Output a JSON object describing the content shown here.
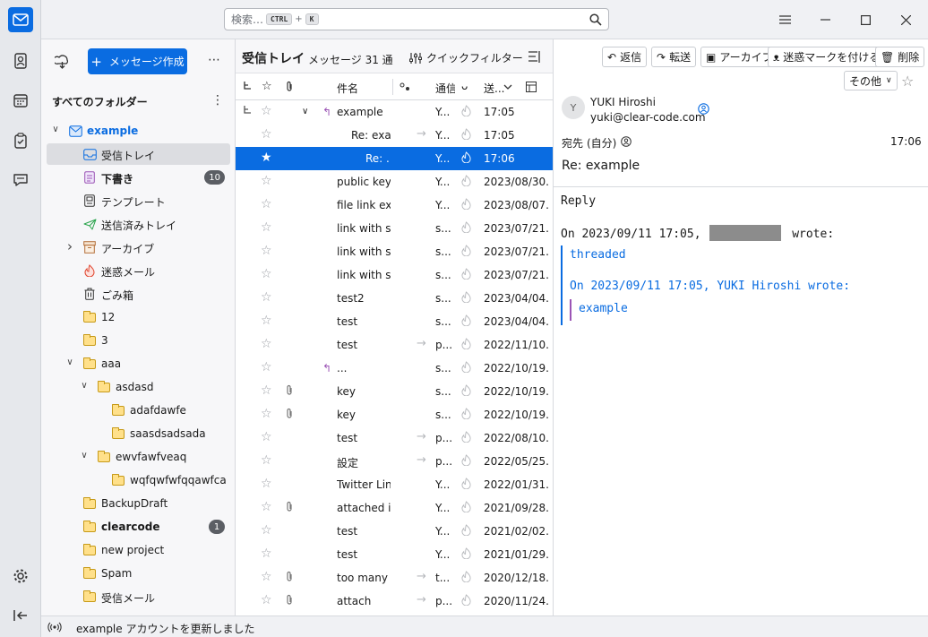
{
  "spaces": {
    "items": [
      "mail",
      "address-book",
      "calendar",
      "tasks",
      "chat"
    ],
    "bottom": [
      "settings",
      "collapse"
    ]
  },
  "search": {
    "placeholder": "検索…",
    "key1": "CTRL",
    "plus": "+",
    "key2": "K"
  },
  "folders": {
    "compose_label": "メッセージ作成",
    "header": "すべてのフォルダー",
    "more": "⋯",
    "menu": "⋮",
    "items": [
      {
        "label": "example",
        "depth": 0,
        "twisty": "open",
        "icon": "account-icon",
        "bold": true,
        "accent": true
      },
      {
        "label": "受信トレイ",
        "depth": 1,
        "icon": "inbox-icon",
        "selected": true
      },
      {
        "label": "下書き",
        "depth": 1,
        "icon": "drafts-icon",
        "bold": true,
        "badge": "10"
      },
      {
        "label": "テンプレート",
        "depth": 1,
        "icon": "template-icon"
      },
      {
        "label": "送信済みトレイ",
        "depth": 1,
        "icon": "sent-icon"
      },
      {
        "label": "アーカイブ",
        "depth": 1,
        "twisty": "closed",
        "icon": "archive-icon"
      },
      {
        "label": "迷惑メール",
        "depth": 1,
        "icon": "junk-icon"
      },
      {
        "label": "ごみ箱",
        "depth": 1,
        "icon": "trash-icon"
      },
      {
        "label": "12",
        "depth": 1,
        "icon": "folder-icon"
      },
      {
        "label": "3",
        "depth": 1,
        "icon": "folder-icon"
      },
      {
        "label": "aaa",
        "depth": 1,
        "twisty": "open",
        "icon": "folder-icon"
      },
      {
        "label": "asdasd",
        "depth": 2,
        "twisty": "open",
        "icon": "folder-icon"
      },
      {
        "label": "adafdawfe",
        "depth": 3,
        "icon": "folder-icon"
      },
      {
        "label": "saasdsadsada",
        "depth": 3,
        "icon": "folder-icon"
      },
      {
        "label": "ewvfawfveaq",
        "depth": 2,
        "twisty": "open",
        "icon": "folder-icon"
      },
      {
        "label": "wqfqwfwfqqawfca",
        "depth": 3,
        "icon": "folder-icon"
      },
      {
        "label": "BackupDraft",
        "depth": 1,
        "icon": "folder-icon"
      },
      {
        "label": "clearcode",
        "depth": 1,
        "icon": "folder-icon",
        "bold": true,
        "badge": "1"
      },
      {
        "label": "new project",
        "depth": 1,
        "icon": "folder-icon"
      },
      {
        "label": "Spam",
        "depth": 1,
        "icon": "folder-icon"
      },
      {
        "label": "受信メール",
        "depth": 1,
        "icon": "folder-icon"
      }
    ]
  },
  "list": {
    "title": "受信トレイ",
    "count": "メッセージ 31 通",
    "quickfilter": "クイックフィルター",
    "columns": {
      "subject": "件名",
      "correspondent": "通信",
      "date": "送..."
    },
    "rows": [
      {
        "thread": true,
        "twisty": "open",
        "replied": true,
        "subject": "example",
        "who": "Y...",
        "date": "17:05",
        "indent": 0
      },
      {
        "subject": "Re: exa...",
        "who": "Y...",
        "date": "17:05",
        "indent": 1,
        "arrow": true
      },
      {
        "subject": "Re: ...",
        "who": "Y...",
        "date": "17:06",
        "indent": 2,
        "selected": true
      },
      {
        "subject": "public key",
        "who": "Y...",
        "date": "2023/08/30..."
      },
      {
        "subject": "file link ex...",
        "who": "Y...",
        "date": "2023/08/07..."
      },
      {
        "subject": "link with s...",
        "who": "s...",
        "date": "2023/07/21..."
      },
      {
        "subject": "link with s...",
        "who": "s...",
        "date": "2023/07/21..."
      },
      {
        "subject": "link with s...",
        "who": "s...",
        "date": "2023/07/21..."
      },
      {
        "subject": "test2",
        "who": "s...",
        "date": "2023/04/04..."
      },
      {
        "subject": "test",
        "who": "s...",
        "date": "2023/04/04..."
      },
      {
        "subject": "test",
        "who": "p...",
        "date": "2022/11/10...",
        "arrow": true
      },
      {
        "subject": "...",
        "who": "s...",
        "date": "2022/10/19...",
        "replied": true
      },
      {
        "subject": "key",
        "who": "s...",
        "date": "2022/10/19...",
        "attach": true
      },
      {
        "subject": "key",
        "who": "s...",
        "date": "2022/10/19...",
        "attach": true
      },
      {
        "subject": "test",
        "who": "p...",
        "date": "2022/08/10...",
        "arrow": true
      },
      {
        "subject": "設定",
        "who": "p...",
        "date": "2022/05/25...",
        "arrow": true
      },
      {
        "subject": "Twitter Link",
        "who": "Y...",
        "date": "2022/01/31..."
      },
      {
        "subject": "attached i...",
        "who": "Y...",
        "date": "2021/09/28...",
        "attach": true
      },
      {
        "subject": "test",
        "who": "Y...",
        "date": "2021/02/02..."
      },
      {
        "subject": "test",
        "who": "Y...",
        "date": "2021/01/29..."
      },
      {
        "subject": "too many ...",
        "who": "t...",
        "date": "2020/12/18...",
        "attach": true,
        "arrow": true
      },
      {
        "subject": "attach",
        "who": "p...",
        "date": "2020/11/24...",
        "attach": true,
        "arrow": true
      }
    ]
  },
  "reader": {
    "toolbar": {
      "reply": "返信",
      "forward": "転送",
      "archive": "アーカイブ",
      "junk": "迷惑マークを付ける",
      "delete": "削除",
      "other": "その他"
    },
    "from_name": "YUKI Hiroshi",
    "from_email": "yuki@clear-code.com",
    "avatar": "Y",
    "to_label": "宛先",
    "to_value": "(自分)",
    "time": "17:06",
    "subject": "Re: example",
    "body": {
      "line1": "Reply",
      "line2": "On 2023/09/11 17:05,",
      "line2b": "wrote:",
      "q1": "threaded",
      "q2": "On 2023/09/11 17:05, YUKI Hiroshi wrote:",
      "q3": "example"
    },
    "colors": {
      "quote1": "#0a6ce1",
      "quote2": "#9b54b5"
    }
  },
  "status": {
    "text": "example アカウントを更新しました"
  }
}
